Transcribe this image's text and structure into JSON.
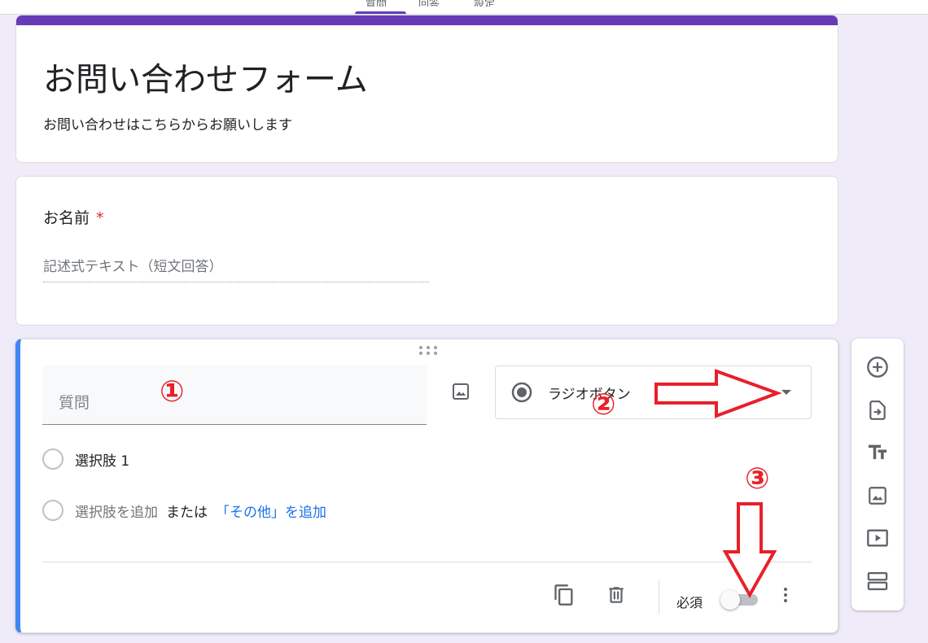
{
  "top_tabs": [
    "質問",
    "回答",
    "設定"
  ],
  "form": {
    "title": "お問い合わせフォーム",
    "description": "お問い合わせはこちらからお願いします"
  },
  "name_question": {
    "title": "お名前",
    "required_mark": "*",
    "answer_placeholder": "記述式テキスト（短文回答）"
  },
  "active_question": {
    "placeholder": "質問",
    "type_label": "ラジオボタン",
    "option_1": "選択肢 1",
    "add_option": "選択肢を追加",
    "or_text": "または",
    "add_other": "「その他」を追加",
    "required_label": "必須",
    "required_on": false
  },
  "side_toolbar": [
    "add-question-icon",
    "import-questions-icon",
    "add-title-icon",
    "add-image-icon",
    "add-video-icon",
    "add-section-icon"
  ],
  "annotations": {
    "badge_1": "①",
    "badge_2": "②",
    "badge_3": "③",
    "color": "#e8202a"
  },
  "colors": {
    "accent": "#673ab7",
    "active_border": "#4285f4",
    "link": "#1a73e8",
    "background": "#f0ebf8"
  }
}
